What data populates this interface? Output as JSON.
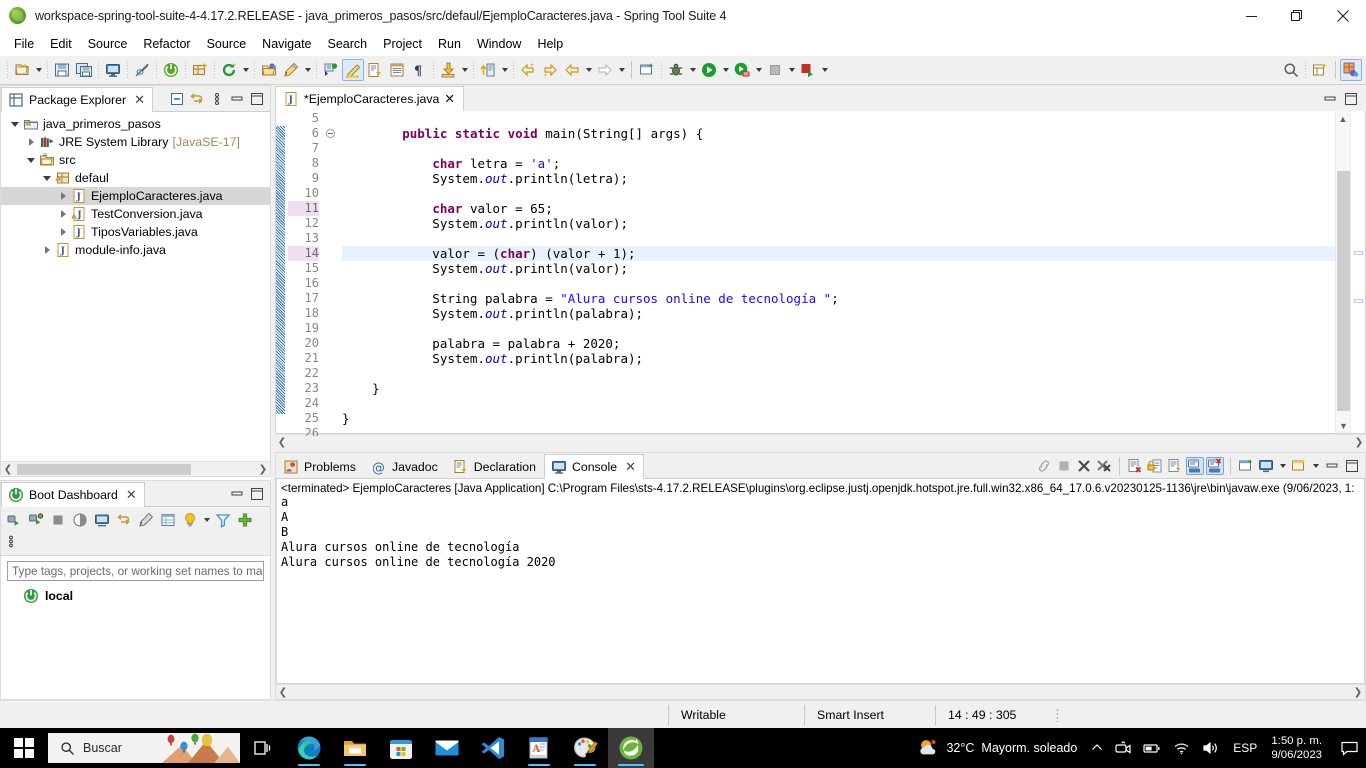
{
  "window": {
    "title": "workspace-spring-tool-suite-4-4.17.2.RELEASE - java_primeros_pasos/src/defaul/EjemploCaracteres.java - Spring Tool Suite 4",
    "app_icon": "spring-leaf-icon",
    "minimize_label": "Minimize",
    "restore_label": "Restore",
    "close_label": "Close"
  },
  "menubar": {
    "items": [
      {
        "label": "File"
      },
      {
        "label": "Edit"
      },
      {
        "label": "Source"
      },
      {
        "label": "Refactor"
      },
      {
        "label": "Source"
      },
      {
        "label": "Navigate"
      },
      {
        "label": "Search"
      },
      {
        "label": "Project"
      },
      {
        "label": "Run"
      },
      {
        "label": "Window"
      },
      {
        "label": "Help"
      }
    ]
  },
  "toolbar": {
    "buttons": [
      {
        "name": "new-wizard-icon",
        "dropdown": true
      },
      {
        "name": "save-icon",
        "dropdown": false
      },
      {
        "name": "save-all-icon",
        "dropdown": false
      },
      {
        "name": "open-console-icon",
        "dropdown": false
      },
      {
        "name": "toggle-mark-occurrences-icon",
        "dropdown": false
      },
      {
        "name": "spring-boot-icon",
        "dropdown": false
      },
      {
        "name": "new-java-package-icon",
        "dropdown": false
      },
      {
        "name": "refresh-icon",
        "dropdown": true
      },
      {
        "name": "open-type-icon",
        "dropdown": false
      },
      {
        "name": "quick-access-pencil-icon",
        "dropdown": true
      },
      {
        "name": "toggle-breadcrumb-icon",
        "dropdown": false
      },
      {
        "name": "highlight-icon",
        "dropdown": false,
        "active": true
      },
      {
        "name": "open-task-icon",
        "dropdown": false
      },
      {
        "name": "open-declaration-icon",
        "dropdown": false
      },
      {
        "name": "show-whitespace-icon",
        "dropdown": false
      },
      {
        "name": "export-icon",
        "dropdown": true
      },
      {
        "name": "last-edit-location-icon",
        "dropdown": true
      },
      {
        "name": "previous-annotation-icon",
        "dropdown": false
      },
      {
        "name": "next-annotation-icon",
        "dropdown": false
      },
      {
        "name": "back-icon",
        "dropdown": true
      },
      {
        "name": "forward-icon",
        "dropdown": true
      },
      {
        "name": "new-window-icon",
        "dropdown": false
      },
      {
        "name": "debug-icon",
        "dropdown": true
      },
      {
        "name": "run-icon",
        "dropdown": true
      },
      {
        "name": "run-coverage-icon",
        "dropdown": true
      },
      {
        "name": "terminate-icon",
        "dropdown": true
      },
      {
        "name": "stop-relaunch-icon",
        "dropdown": true
      }
    ],
    "right_buttons": [
      {
        "name": "search-icon"
      },
      {
        "name": "new-spreadsheet-icon"
      },
      {
        "name": "java-perspective-icon",
        "active": true
      }
    ]
  },
  "package_explorer": {
    "tab_label": "Package Explorer",
    "close_label": "✕",
    "actions": [
      {
        "name": "collapse-all-icon"
      },
      {
        "name": "link-with-editor-icon"
      },
      {
        "name": "view-menu-icon"
      },
      {
        "name": "minimize-view-icon"
      },
      {
        "name": "maximize-view-icon"
      }
    ],
    "tree": [
      {
        "label": "java_primeros_pasos",
        "sub": "",
        "indent": 0,
        "twisty": "down",
        "icon": "java-project-warning-icon",
        "selected": false
      },
      {
        "label": "JRE System Library",
        "sub": "[JavaSE-17]",
        "indent": 1,
        "twisty": "right",
        "icon": "library-icon",
        "selected": false
      },
      {
        "label": "src",
        "sub": "",
        "indent": 1,
        "twisty": "down",
        "icon": "source-folder-icon",
        "selected": false
      },
      {
        "label": "defaul",
        "sub": "",
        "indent": 2,
        "twisty": "down",
        "icon": "package-warning-icon",
        "selected": false
      },
      {
        "label": "EjemploCaracteres.java",
        "sub": "",
        "indent": 3,
        "twisty": "right",
        "icon": "java-file-icon",
        "selected": true
      },
      {
        "label": "TestConversion.java",
        "sub": "",
        "indent": 3,
        "twisty": "right",
        "icon": "java-file-warning-icon",
        "selected": false
      },
      {
        "label": "TiposVariables.java",
        "sub": "",
        "indent": 3,
        "twisty": "right",
        "icon": "java-file-icon",
        "selected": false
      },
      {
        "label": "module-info.java",
        "sub": "",
        "indent": 2,
        "twisty": "right",
        "icon": "java-file-icon",
        "selected": false
      }
    ]
  },
  "boot_dashboard": {
    "tab_label": "Boot Dashboard",
    "close_label": "✕",
    "toolbar_icons": [
      "start-icon",
      "debug-start-icon",
      "stop-icon",
      "restart-icon",
      "open-console-icon",
      "toggle-devtools-icon",
      "edit-icon",
      "open-properties-icon",
      "lightbulb-icon",
      "dropdown-icon",
      "filter-icon",
      "add-icon",
      "view-menu-icon"
    ],
    "filter_placeholder": "Type tags, projects, or working set names to ma",
    "filter_value": "",
    "items": [
      {
        "label": "local",
        "icon": "spring-boot-local-icon"
      }
    ]
  },
  "editor": {
    "tab_label": "*EjemploCaracteres.java",
    "tab_icon": "java-file-icon",
    "close_label": "✕",
    "actions": [
      {
        "name": "minimize-editor-icon"
      },
      {
        "name": "maximize-editor-icon"
      }
    ],
    "first_line": 5,
    "last_line": 26,
    "highlight_line": 14,
    "changed_lines": [
      11,
      14
    ],
    "folding_line": 6,
    "lines": [
      {
        "n": 5,
        "tokens": []
      },
      {
        "n": 6,
        "tokens": [
          {
            "t": "        ",
            "c": "pl"
          },
          {
            "t": "public static void ",
            "c": "kw"
          },
          {
            "t": "main(String[] args) {",
            "c": "pl"
          }
        ]
      },
      {
        "n": 7,
        "tokens": []
      },
      {
        "n": 8,
        "tokens": [
          {
            "t": "            ",
            "c": "pl"
          },
          {
            "t": "char",
            "c": "kw"
          },
          {
            "t": " letra = ",
            "c": "pl"
          },
          {
            "t": "'a'",
            "c": "str"
          },
          {
            "t": ";",
            "c": "pl"
          }
        ]
      },
      {
        "n": 9,
        "tokens": [
          {
            "t": "            System.",
            "c": "pl"
          },
          {
            "t": "out",
            "c": "fld"
          },
          {
            "t": ".println(letra);",
            "c": "pl"
          }
        ]
      },
      {
        "n": 10,
        "tokens": []
      },
      {
        "n": 11,
        "tokens": [
          {
            "t": "            ",
            "c": "pl"
          },
          {
            "t": "char",
            "c": "kw"
          },
          {
            "t": " valor = 65;",
            "c": "pl"
          }
        ]
      },
      {
        "n": 12,
        "tokens": [
          {
            "t": "            System.",
            "c": "pl"
          },
          {
            "t": "out",
            "c": "fld"
          },
          {
            "t": ".println(valor);",
            "c": "pl"
          }
        ]
      },
      {
        "n": 13,
        "tokens": []
      },
      {
        "n": 14,
        "tokens": [
          {
            "t": "            valor = (",
            "c": "pl"
          },
          {
            "t": "char",
            "c": "kw"
          },
          {
            "t": ") (valor + 1);",
            "c": "pl"
          }
        ]
      },
      {
        "n": 15,
        "tokens": [
          {
            "t": "            System.",
            "c": "pl"
          },
          {
            "t": "out",
            "c": "fld"
          },
          {
            "t": ".println(valor);",
            "c": "pl"
          }
        ]
      },
      {
        "n": 16,
        "tokens": []
      },
      {
        "n": 17,
        "tokens": [
          {
            "t": "            String palabra = ",
            "c": "pl"
          },
          {
            "t": "\"Alura cursos online de tecnología \"",
            "c": "str"
          },
          {
            "t": ";",
            "c": "pl"
          }
        ]
      },
      {
        "n": 18,
        "tokens": [
          {
            "t": "            System.",
            "c": "pl"
          },
          {
            "t": "out",
            "c": "fld"
          },
          {
            "t": ".println(palabra);",
            "c": "pl"
          }
        ]
      },
      {
        "n": 19,
        "tokens": []
      },
      {
        "n": 20,
        "tokens": [
          {
            "t": "            palabra = palabra + 2020;",
            "c": "pl"
          }
        ]
      },
      {
        "n": 21,
        "tokens": [
          {
            "t": "            System.",
            "c": "pl"
          },
          {
            "t": "out",
            "c": "fld"
          },
          {
            "t": ".println(palabra);",
            "c": "pl"
          }
        ]
      },
      {
        "n": 22,
        "tokens": []
      },
      {
        "n": 23,
        "tokens": [
          {
            "t": "    }",
            "c": "pl"
          }
        ]
      },
      {
        "n": 24,
        "tokens": []
      },
      {
        "n": 25,
        "tokens": [
          {
            "t": "}",
            "c": "pl"
          }
        ]
      },
      {
        "n": 26,
        "tokens": []
      }
    ]
  },
  "bottom_panel": {
    "tabs": [
      {
        "label": "Problems",
        "icon": "problems-icon",
        "active": false
      },
      {
        "label": "Javadoc",
        "icon": "javadoc-icon",
        "active": false
      },
      {
        "label": "Declaration",
        "icon": "declaration-icon",
        "active": false
      },
      {
        "label": "Console",
        "icon": "console-icon",
        "active": true
      }
    ],
    "close_label": "✕",
    "actions": [
      {
        "name": "link-icon"
      },
      {
        "name": "terminate-icon"
      },
      {
        "name": "remove-launch-icon"
      },
      {
        "name": "remove-all-terminated-icon"
      },
      {
        "name": "clear-console-icon"
      },
      {
        "name": "scroll-lock-icon"
      },
      {
        "name": "word-wrap-icon"
      },
      {
        "name": "show-console-on-output-icon",
        "active": true
      },
      {
        "name": "show-console-on-error-icon",
        "active": true
      },
      {
        "name": "pin-console-icon"
      },
      {
        "name": "display-selected-console-icon",
        "dropdown": true
      },
      {
        "name": "open-console-icon",
        "dropdown": true
      },
      {
        "name": "minimize-view-icon"
      },
      {
        "name": "maximize-view-icon"
      }
    ],
    "console": {
      "header": "<terminated> EjemploCaracteres [Java Application] C:\\Program Files\\sts-4.17.2.RELEASE\\plugins\\org.eclipse.justj.openjdk.hotspot.jre.full.win32.x86_64_17.0.6.v20230125-1136\\jre\\bin\\javaw.exe  (9/06/2023, 1:",
      "lines": [
        "a",
        "A",
        "B",
        "Alura cursos online de tecnología",
        "Alura cursos online de tecnología 2020"
      ]
    }
  },
  "statusbar": {
    "writable": "Writable",
    "insert_mode": "Smart Insert",
    "position": "14 : 49 : 305"
  },
  "taskbar": {
    "start_label": "Start",
    "search_placeholder": "Buscar",
    "task_view_label": "Task View",
    "apps": [
      {
        "name": "edge-icon",
        "running": true,
        "focused": false
      },
      {
        "name": "file-explorer-icon",
        "running": true,
        "focused": false
      },
      {
        "name": "microsoft-store-icon",
        "running": false,
        "focused": false
      },
      {
        "name": "mail-icon",
        "running": false,
        "focused": false
      },
      {
        "name": "vscode-icon",
        "running": false,
        "focused": false
      },
      {
        "name": "text-editor-icon",
        "running": true,
        "focused": false
      },
      {
        "name": "paint-icon",
        "running": true,
        "focused": false
      },
      {
        "name": "spring-tool-suite-icon",
        "running": true,
        "focused": true
      }
    ],
    "weather": {
      "icon": "partly-cloudy-icon",
      "temperature": "32°C",
      "condition": "Mayorm. soleado"
    },
    "tray": [
      {
        "name": "show-hidden-icons-chevron"
      },
      {
        "name": "camera-icon"
      },
      {
        "name": "battery-icon"
      },
      {
        "name": "wifi-icon"
      },
      {
        "name": "volume-icon"
      }
    ],
    "language": "ESP",
    "time": "1:50 p. m.",
    "date": "9/06/2023",
    "notification_label": "Notifications"
  },
  "colors": {
    "accent_blue": "#0078d7",
    "keyword_purple": "#7f0055",
    "string_blue": "#2a00ff",
    "field_blue": "#0000c0",
    "highlight_line": "#e8f2fe",
    "selection_gray": "#d6d6d6",
    "toolbar_bg": "#f0f0f0",
    "spring_green": "#6db33f"
  }
}
